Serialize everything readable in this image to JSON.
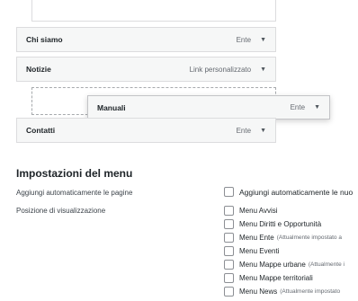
{
  "menu_items": {
    "chi_siamo": {
      "title": "Chi siamo",
      "type": "Ente"
    },
    "notizie": {
      "title": "Notizie",
      "type": "Link personalizzato"
    },
    "manuali": {
      "title": "Manuali",
      "type": "Ente"
    },
    "contatti": {
      "title": "Contatti",
      "type": "Ente"
    },
    "caret": "▼"
  },
  "settings": {
    "title": "Impostazioni del menu",
    "auto_add_label": "Aggiungi automaticamente le pagine",
    "auto_add_option": "Aggiungi automaticamente le nuo",
    "location_label": "Posizione di visualizzazione",
    "locations": [
      {
        "label": "Menu Avvisi",
        "note": ""
      },
      {
        "label": "Menu Diritti e Opportunità",
        "note": ""
      },
      {
        "label": "Menu Ente",
        "note": "(Attualmente impostato a"
      },
      {
        "label": "Menu Eventi",
        "note": ""
      },
      {
        "label": "Menu Mappe urbane",
        "note": "(Attualmente i"
      },
      {
        "label": "Menu Mappe territoriali",
        "note": ""
      },
      {
        "label": "Menu News",
        "note": "(Attualmente impostato"
      }
    ]
  }
}
